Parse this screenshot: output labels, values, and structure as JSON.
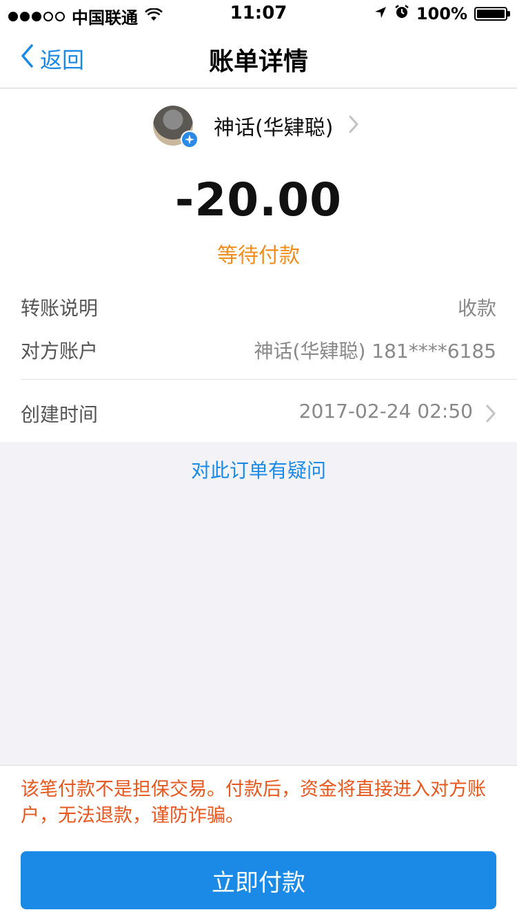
{
  "status_bar": {
    "carrier": "中国联通",
    "time": "11:07",
    "battery": "100%",
    "signal_dots_filled": 3,
    "signal_dots_total": 5
  },
  "nav": {
    "back_label": "返回",
    "title": "账单详情"
  },
  "payee": {
    "name": "神话(华肄聪)"
  },
  "amount": "-20.00",
  "status": "等待付款",
  "details": {
    "transfer_note_label": "转账说明",
    "transfer_note_value": "收款",
    "account_label": "对方账户",
    "account_value": "神话(华肄聪) 181****6185",
    "created_label": "创建时间",
    "created_value": "2017-02-24 02:50"
  },
  "question_link": "对此订单有疑问",
  "warning": "该笔付款不是担保交易。付款后，资金将直接进入对方账户，无法退款，谨防诈骗。",
  "pay_button": "立即付款",
  "colors": {
    "accent": "#1a8ae6",
    "status_orange": "#f28c1b",
    "warning_red": "#e8571e"
  }
}
